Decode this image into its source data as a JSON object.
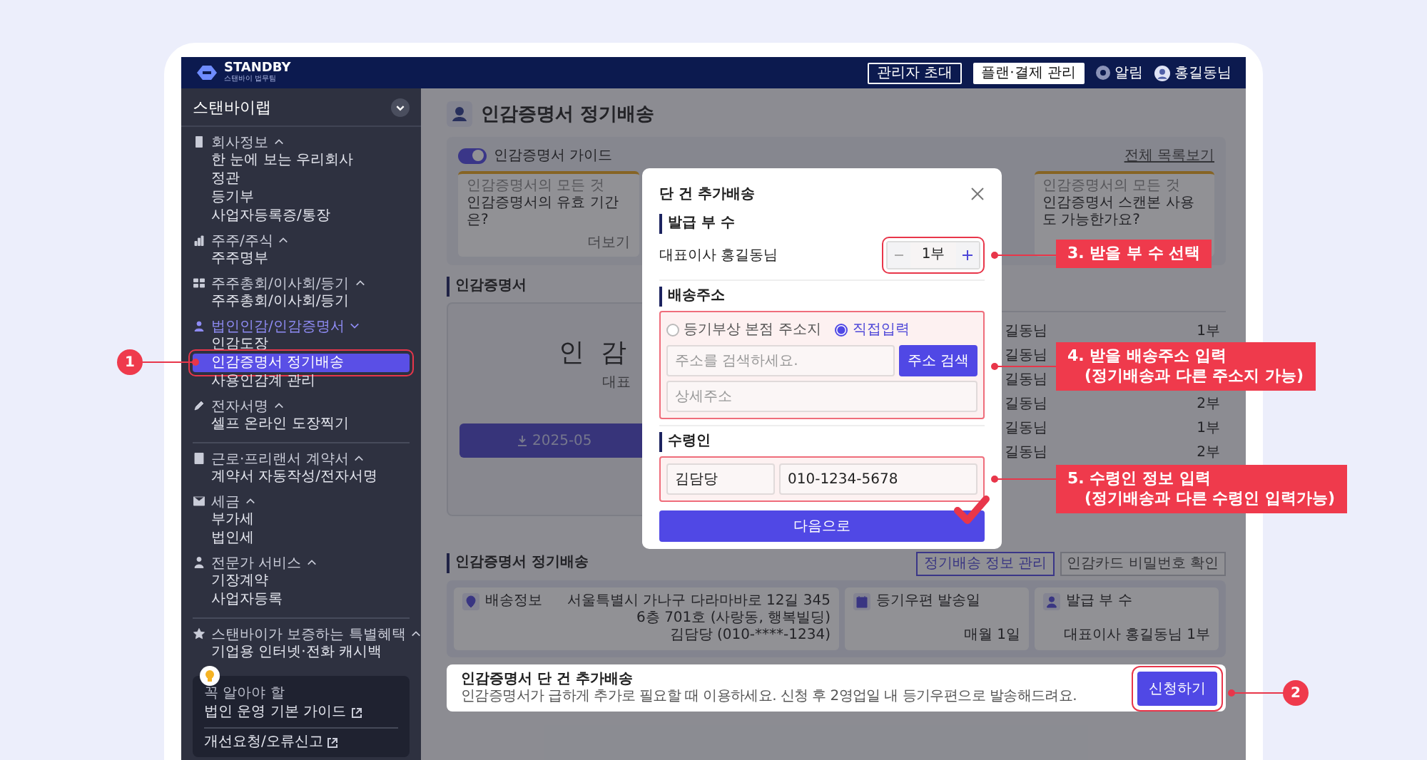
{
  "top_bar": {
    "logo": "STANDBY",
    "logo_subtitle": "스탠바이 법무팀",
    "buttons": [
      {
        "label": "관리자 초대",
        "kind": "outline"
      },
      {
        "label": "플랜·결제 관리",
        "kind": "solid"
      }
    ],
    "notifications": "알림",
    "user": "홍길동님"
  },
  "sidebar": {
    "company": "스탠바이랩",
    "sections": [
      {
        "groups": [
          {
            "title": "회사정보",
            "active": false,
            "items": [
              {
                "label": "한 눈에 보는 우리회사",
                "selected": false
              },
              {
                "label": "정관",
                "selected": false
              },
              {
                "label": "등기부",
                "selected": false
              },
              {
                "label": "사업자등록증/통장",
                "selected": false
              }
            ]
          },
          {
            "title": "주주/주식",
            "active": false,
            "items": [
              {
                "label": "주주명부",
                "selected": false
              }
            ]
          },
          {
            "title": "주주총회/이사회/등기",
            "active": false,
            "items": [
              {
                "label": "주주총회/이사회/등기",
                "selected": false
              }
            ]
          },
          {
            "title": "법인인감/인감증명서",
            "active": true,
            "items": [
              {
                "label": "인감도장",
                "selected": false
              },
              {
                "label": "인감증명서 정기배송",
                "selected": true
              },
              {
                "label": "사용인감계 관리",
                "selected": false
              }
            ]
          },
          {
            "title": "전자서명",
            "active": false,
            "items": [
              {
                "label": "셀프 온라인 도장찍기",
                "selected": false
              }
            ]
          }
        ]
      },
      {
        "groups": [
          {
            "title": "근로·프리랜서 계약서",
            "active": false,
            "items": [
              {
                "label": "계약서 자동작성/전자서명",
                "selected": false
              }
            ]
          },
          {
            "title": "세금",
            "active": false,
            "items": [
              {
                "label": "부가세",
                "selected": false
              },
              {
                "label": "법인세",
                "selected": false
              }
            ]
          },
          {
            "title": "전문가 서비스",
            "active": false,
            "items": [
              {
                "label": "기장계약",
                "selected": false
              },
              {
                "label": "사업자등록",
                "selected": false
              }
            ]
          }
        ]
      },
      {
        "groups": [
          {
            "title": "스탠바이가 보증하는 특별혜택",
            "active": false,
            "items": [
              {
                "label": "기업용 인터넷·전화 캐시백",
                "selected": false
              }
            ]
          }
        ]
      }
    ],
    "help_box": {
      "caption": "꼭 알아야 할",
      "links": [
        "법인 운영 기본 가이드",
        "개선요청/오류신고"
      ]
    }
  },
  "page": {
    "title": "인감증명서 정기배송"
  },
  "guide": {
    "title": "인감증명서 가이드",
    "on": true,
    "link": "전체 목록보기",
    "cards": [
      {
        "category": "인감증명서의 모든 것",
        "question": "인감증명서의 유효 기간은?",
        "more": "더보기"
      },
      {
        "category": "인감증명서의 모든 것",
        "question": "인감증명서 스캔본 사용도 가능한가요?"
      }
    ]
  },
  "certificate": {
    "heading": "인감증명서",
    "title": "인 감",
    "subtitle": "대표",
    "download": "2025-05",
    "rows": [
      {
        "name": "길동님",
        "count": "1부"
      },
      {
        "name": "길동님"
      },
      {
        "name": "길동님"
      },
      {
        "name": "길동님",
        "count": "2부"
      },
      {
        "name": "길동님",
        "count": "1부"
      },
      {
        "name": "길동님",
        "count": "2부"
      }
    ]
  },
  "regular_delivery": {
    "heading": "인감증명서 정기배송",
    "buttons": [
      {
        "label": "정기배송 정보 관리",
        "selected": true
      },
      {
        "label": "인감카드 비밀번호 확인",
        "selected": false
      }
    ],
    "cards": [
      {
        "title": "배송정보",
        "lines": [
          "서울특별시 가나구 다라마바로 12길 345",
          "6층 701호 (사랑동, 행복빌딩)",
          "김담당 (010-****-1234)"
        ]
      },
      {
        "title": "등기우편 발송일",
        "lines": [
          "매월 1일"
        ]
      },
      {
        "title": "발급 부 수",
        "lines": [
          "대표이사 홍길동님  1부"
        ]
      }
    ]
  },
  "extra_delivery": {
    "title": "인감증명서 단 건 추가배송",
    "description": "인감증명서가 급하게 추가로 필요할 때 이용하세요. 신청 후 2영업일 내 등기우편으로 발송해드려요.",
    "button": "신청하기"
  },
  "modal": {
    "title": "단 건 추가배송",
    "copies": {
      "heading": "발급 부 수",
      "label": "대표이사 홍길동님",
      "value": "1부"
    },
    "address": {
      "heading": "배송주소",
      "options": [
        {
          "label": "등기부상 본점 주소지",
          "selected": false
        },
        {
          "label": "직접입력",
          "selected": true
        }
      ],
      "search_placeholder": "주소를 검색하세요.",
      "search_button": "주소 검색",
      "detail_placeholder": "상세주소"
    },
    "recipient": {
      "heading": "수령인",
      "name": "김담당",
      "phone": "010-1234-5678"
    },
    "submit": "다음으로"
  },
  "badges": [
    "1",
    "2"
  ],
  "callouts": [
    {
      "lines": [
        "3. 받을 부 수 선택"
      ]
    },
    {
      "lines": [
        "4. 받을 배송주소 입력",
        "(정기배송과 다른 주소지 가능)"
      ]
    },
    {
      "lines": [
        "5. 수령인 정보 입력",
        "(정기배송과 다른 수령인 입력가능)"
      ]
    }
  ]
}
